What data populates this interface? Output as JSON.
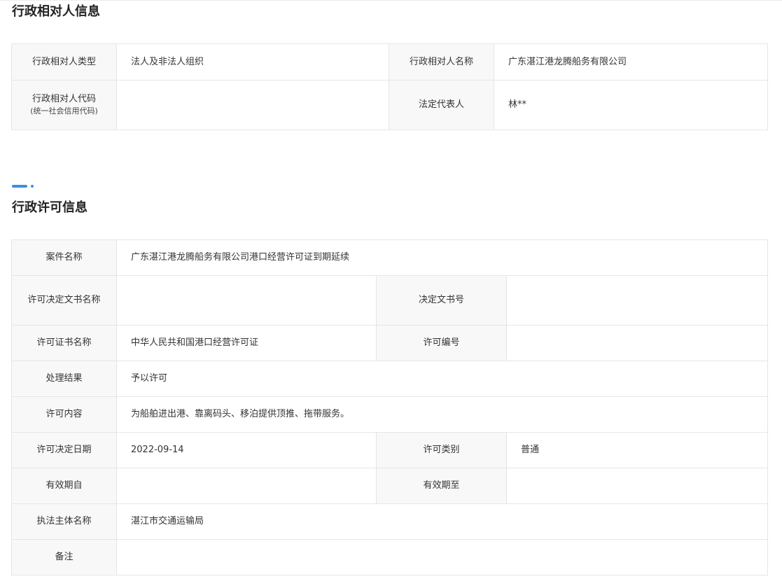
{
  "party_section": {
    "title": "行政相对人信息",
    "type_label": "行政相对人类型",
    "type_value": "法人及非法人组织",
    "name_label": "行政相对人名称",
    "name_value": "广东湛江港龙腾船务有限公司",
    "code_label": "行政相对人代码",
    "code_sublabel": "(统一社会信用代码)",
    "code_value": "",
    "rep_label": "法定代表人",
    "rep_value": "林**"
  },
  "license_section": {
    "title": "行政许可信息",
    "case_name_label": "案件名称",
    "case_name_value": "广东湛江港龙腾船务有限公司港口经营许可证到期延续",
    "doc_name_label": "许可决定文书名称",
    "doc_name_value": "",
    "doc_no_label": "决定文书号",
    "doc_no_value": "",
    "cert_name_label": "许可证书名称",
    "cert_name_value": "中华人民共和国港口经营许可证",
    "license_no_label": "许可编号",
    "license_no_value": "",
    "result_label": "处理结果",
    "result_value": "予以许可",
    "content_label": "许可内容",
    "content_value": "为船舶进出港、靠离码头、移泊提供顶推、拖带服务。",
    "date_label": "许可决定日期",
    "date_value": "2022-09-14",
    "category_label": "许可类别",
    "category_value": "普通",
    "valid_from_label": "有效期自",
    "valid_from_value": "",
    "valid_to_label": "有效期至",
    "valid_to_value": "",
    "authority_label": "执法主体名称",
    "authority_value": "湛江市交通运输局",
    "remark_label": "备注",
    "remark_value": ""
  },
  "colors": {
    "accent": "#3a8ee6",
    "label_bg": "#f8f8f8",
    "border": "#e6e6e6"
  }
}
